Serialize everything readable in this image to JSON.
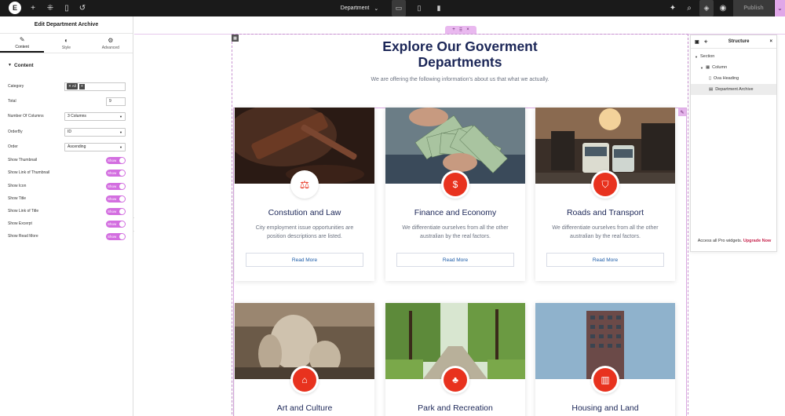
{
  "topbar": {
    "logo": "E",
    "doc_title": "Department",
    "doc_caret": "⌄",
    "publish": "Publish",
    "icons": [
      "plus-icon",
      "settings-icon",
      "page-icon",
      "history-icon"
    ]
  },
  "panel": {
    "title": "Edit Department Archive",
    "tabs": [
      {
        "label": "Content",
        "icon": "pencil-icon"
      },
      {
        "label": "Style",
        "icon": "halfcircle-icon"
      },
      {
        "label": "Advanced",
        "icon": "gear-icon"
      }
    ],
    "section": "Content",
    "category_label": "Category",
    "category_tag": "✕ All",
    "category_plus": "+",
    "total_label": "Total",
    "total_value": "9",
    "columns_label": "Number Of Columns",
    "columns_value": "3 Columns",
    "orderby_label": "OrderBy",
    "orderby_value": "ID",
    "order_label": "Order",
    "order_value": "Ascending",
    "toggles": [
      {
        "label": "Show Thumbnail",
        "state": "Show"
      },
      {
        "label": "Show Link of Thumbnail",
        "state": "Show"
      },
      {
        "label": "Show Icon",
        "state": "Show"
      },
      {
        "label": "Show Title",
        "state": "Show"
      },
      {
        "label": "Show Link of Title",
        "state": "Show"
      },
      {
        "label": "Show Excerpt",
        "state": "Show"
      },
      {
        "label": "Show Read More",
        "state": "Show"
      }
    ]
  },
  "canvas": {
    "heading": "Explore Our Goverment Departments",
    "subheading": "We are offering the following information's about us that what we actually.",
    "cards": [
      {
        "title": "Constution and Law",
        "desc": "City employment issue opportunities are position descriptions are listed.",
        "btn": "Read More",
        "icon": "scales-icon",
        "icon_bg": "#ffffff",
        "icon_color": "#e8321e",
        "img": "gavel"
      },
      {
        "title": "Finance and Economy",
        "desc": "We differentiate ourselves from all the other australian by the real factors.",
        "btn": "Read More",
        "icon": "money-bag-icon",
        "icon_bg": "#e8321e",
        "icon_color": "#ffffff",
        "img": "money"
      },
      {
        "title": "Roads and Transport",
        "desc": "We differentiate ourselves from all the other australian by the real factors.",
        "btn": "Read More",
        "icon": "road-icon",
        "icon_bg": "#e8321e",
        "icon_color": "#ffffff",
        "img": "tram"
      },
      {
        "title": "Art and Culture",
        "desc": "",
        "btn": "",
        "icon": "museum-icon",
        "icon_bg": "#e8321e",
        "icon_color": "#ffffff",
        "img": "statue"
      },
      {
        "title": "Park and Recreation",
        "desc": "",
        "btn": "",
        "icon": "park-icon",
        "icon_bg": "#e8321e",
        "icon_color": "#ffffff",
        "img": "park"
      },
      {
        "title": "Housing and Land",
        "desc": "",
        "btn": "",
        "icon": "building-icon",
        "icon_bg": "#e8321e",
        "icon_color": "#ffffff",
        "img": "tower"
      }
    ]
  },
  "structure": {
    "title": "Structure",
    "items": [
      {
        "label": "Section",
        "level": 0
      },
      {
        "label": "Column",
        "level": 1
      },
      {
        "label": "Ova Heading",
        "level": 2
      },
      {
        "label": "Department Archive",
        "level": 2
      }
    ],
    "footer_text": "Access all Pro widgets.",
    "footer_link": "Upgrade Now"
  },
  "colors": {
    "accent": "#d36ee0",
    "brand_red": "#e8321e",
    "navy": "#1b2657"
  }
}
